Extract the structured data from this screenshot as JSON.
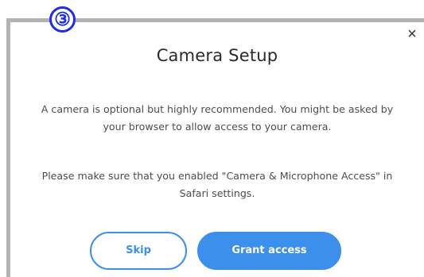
{
  "step": {
    "number": "③"
  },
  "dialog": {
    "close_glyph": "×",
    "title": "Camera Setup",
    "paragraph_1_line_1": "A camera is optional but highly recommended. You might be asked by",
    "paragraph_1_line_2": "your browser to allow access to your camera.",
    "paragraph_2_line_1": "Please make sure that you enabled \"Camera & Microphone Access\" in",
    "paragraph_2_line_2": "Safari settings.",
    "skip_label": "Skip",
    "grant_label": "Grant access"
  },
  "colors": {
    "accent": "#3d8fec",
    "badge": "#1e2de6",
    "frame": "#b3b3b3"
  },
  "icons": {
    "close": "close-icon",
    "step": "step-number-icon"
  }
}
